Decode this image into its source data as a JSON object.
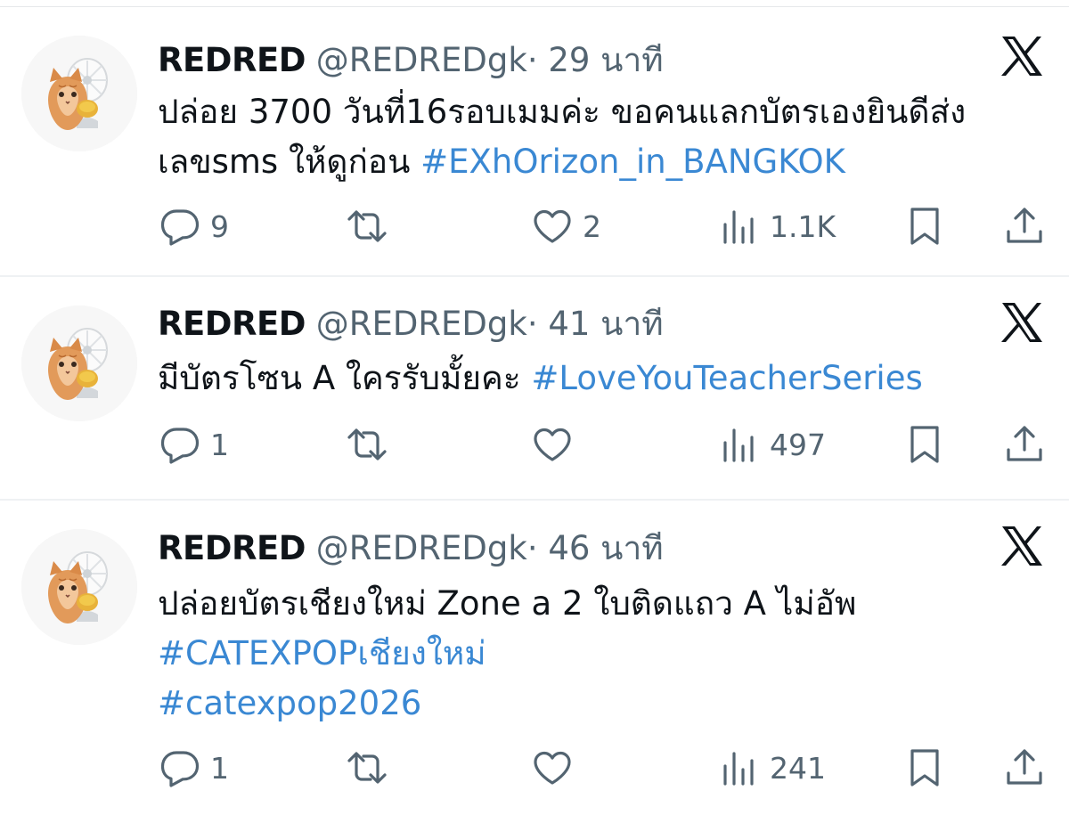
{
  "tweets": [
    {
      "name": "REDRED",
      "handle": "@REDREDgk",
      "dot": "·",
      "time": "29 นาที",
      "lines": [
        [
          {
            "text": "ปล่อย 3700 วันที่16รอบเมมค่ะ ขอคนแลกบัตรเองยินดีส่ง",
            "tag": false
          }
        ],
        [
          {
            "text": "เลขsms ให้ดูก่อน ",
            "tag": false
          },
          {
            "text": "#EXhOrizon_in_BANGKOK",
            "tag": true
          }
        ]
      ],
      "replies": "9",
      "retweets": "",
      "likes": "2",
      "views": "1.1K"
    },
    {
      "name": "REDRED",
      "handle": "@REDREDgk",
      "dot": "·",
      "time": "41 นาที",
      "lines": [
        [
          {
            "text": "มีบัตรโซน A ใครรับมั้ยคะ ",
            "tag": false
          },
          {
            "text": "#LoveYouTeacherSeries",
            "tag": true
          }
        ]
      ],
      "replies": "1",
      "retweets": "",
      "likes": "",
      "views": "497"
    },
    {
      "name": "REDRED",
      "handle": "@REDREDgk",
      "dot": "·",
      "time": "46 นาที",
      "lines": [
        [
          {
            "text": "ปล่อยบัตรเชียงใหม่ Zone a 2 ใบติดแถว A ไม่อัพ",
            "tag": false
          }
        ],
        [
          {
            "text": "#CATEXPOPเชียงใหม่",
            "tag": true
          }
        ],
        [
          {
            "text": " #catexpop2026",
            "tag": true
          }
        ]
      ],
      "replies": "1",
      "retweets": "",
      "likes": "",
      "views": "241"
    }
  ],
  "icons": {
    "reply": "reply-bubble-icon",
    "retweet": "retweet-icon",
    "like": "heart-icon",
    "views": "views-bar-chart-icon",
    "bookmark": "bookmark-icon",
    "share": "share-upload-icon",
    "close": "x-logo-icon",
    "avatar": "kitten-with-fan-avatar"
  },
  "colors": {
    "hashtag": "#3a88d3",
    "muted": "#536471",
    "text": "#0f1419"
  }
}
